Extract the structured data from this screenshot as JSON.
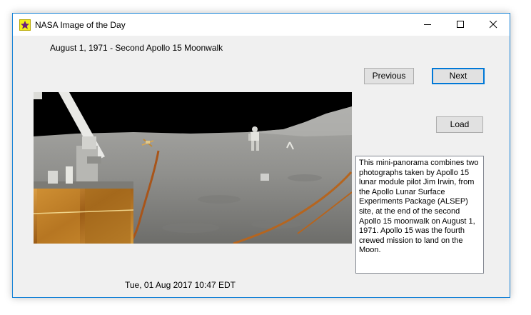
{
  "window": {
    "title": "NASA Image of the Day",
    "controls": [
      "minimize-icon",
      "maximize-icon",
      "close-icon"
    ]
  },
  "image": {
    "caption_title": "August 1, 1971 - Second Apollo 15 Moonwalk",
    "description": "This mini-panorama combines two photographs taken by Apollo 15 lunar module pilot Jim Irwin, from the Apollo Lunar Surface Experiments Package (ALSEP) site, at the end of the second Apollo 15 moonwalk on August 1, 1971. Apollo 15 was the fourth crewed mission to land on the Moon."
  },
  "buttons": {
    "previous": "Previous",
    "next": "Next",
    "load": "Load"
  },
  "status": {
    "timestamp": "Tue, 01 Aug 2017 10:47 EDT"
  },
  "colors": {
    "window_border": "#1883d7",
    "default_button_border": "#0078d7",
    "sky": "#000000",
    "lunar_surface": "#8f8f8d"
  }
}
